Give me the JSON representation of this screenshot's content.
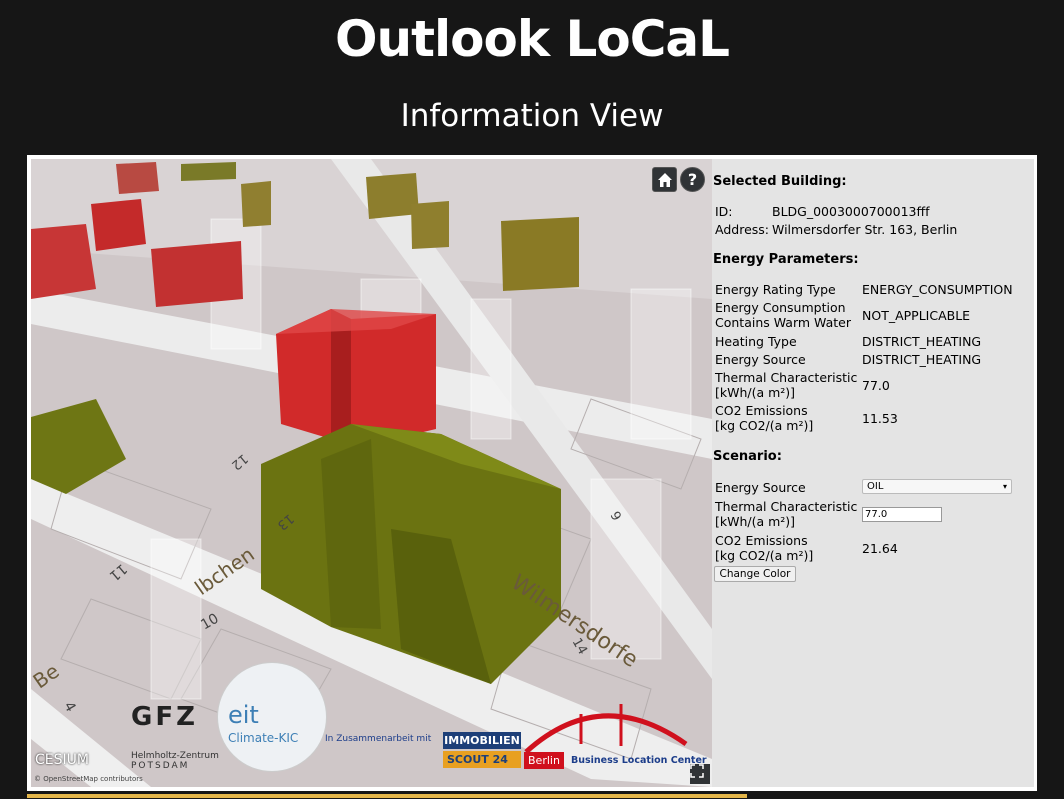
{
  "page": {
    "title": "Outlook LoCaL",
    "subtitle": "Information View"
  },
  "viewer": {
    "home_icon": "home-icon",
    "help_icon": "question-icon",
    "fullscreen_icon": "fullscreen-icon",
    "help_label": "?",
    "street_labels": [
      "Wilmersdorfe",
      "lbchen",
      "Be"
    ],
    "house_numbers": [
      "10",
      "11",
      "12",
      "13",
      "14",
      "9",
      "4"
    ],
    "logos": {
      "gfz": "GFZ",
      "gfz_sub1": "Helmholtz-Zentrum",
      "gfz_sub2": "POTSDAM",
      "eit": "eit",
      "eit_sub": "Climate-KIC",
      "cooperation": "In Zusammenarbeit mit",
      "immobilien": "IMMOBILIEN",
      "scout": "SCOUT 24",
      "berlin": "Berlin",
      "blc": "Business Location Center",
      "cesium": "CESIUM",
      "osm_credit": "© OpenStreetMap contributors"
    }
  },
  "panel": {
    "selected_heading": "Selected Building:",
    "id_label": "ID:",
    "id_value": "BLDG_0003000700013fff",
    "address_label": "Address:",
    "address_value": "Wilmersdorfer Str. 163, Berlin",
    "energy_heading": "Energy Parameters:",
    "energy_rows": [
      {
        "key": "Energy Rating Type",
        "value": "ENERGY_CONSUMPTION"
      },
      {
        "key1": "Energy Consumption",
        "key2": "Contains Warm Water",
        "value": "NOT_APPLICABLE"
      },
      {
        "key": "Heating Type",
        "value": "DISTRICT_HEATING"
      },
      {
        "key": "Energy Source",
        "value": "DISTRICT_HEATING"
      },
      {
        "key1": "Thermal Characteristic",
        "key2": "[kWh/(a m²)]",
        "value": "77.0"
      },
      {
        "key1": "CO2 Emissions",
        "key2": "[kg CO2/(a m²)]",
        "value": "11.53"
      }
    ],
    "scenario_heading": "Scenario:",
    "scenario": {
      "source_label": "Energy Source",
      "source_selected": "OIL",
      "thermal_label1": "Thermal Characteristic",
      "thermal_label2": "[kWh/(a m²)]",
      "thermal_value": "77.0",
      "co2_label1": "CO2 Emissions",
      "co2_label2": "[kg CO2/(a m²)]",
      "co2_value": "21.64",
      "change_color_label": "Change Color"
    }
  },
  "colors": {
    "background": "#161616",
    "panel": "#e4e4e4",
    "building_selected": "#6b7311",
    "building_red": "#c42a2a",
    "building_olive": "#8a7a25",
    "accent_bar": "#e4b64a"
  }
}
